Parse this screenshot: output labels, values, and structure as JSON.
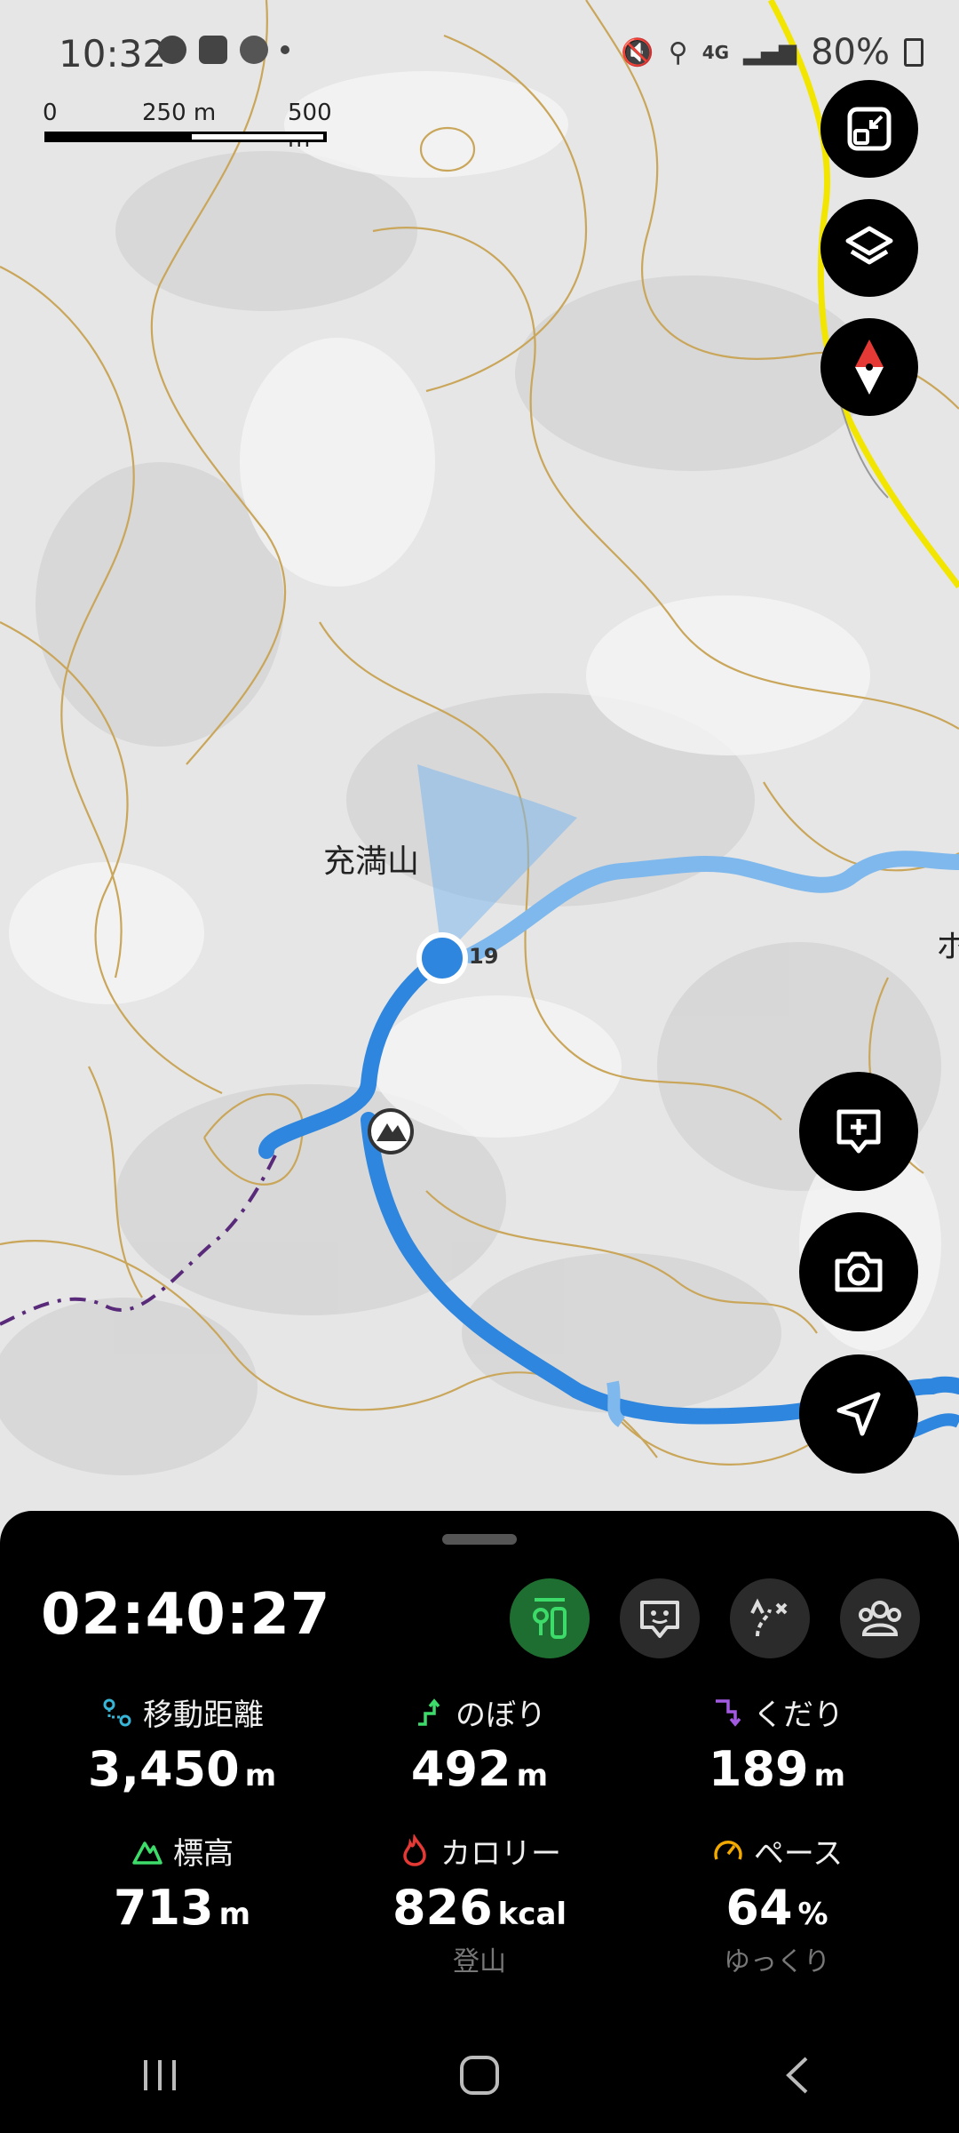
{
  "status_bar": {
    "time": "10:32",
    "battery": "80%",
    "network": "4G"
  },
  "map": {
    "scale_labels": [
      "0",
      "250 m",
      "500 m"
    ],
    "peak_label": "充満山",
    "waypoint_label": "19",
    "edge_label": "ホ",
    "colors": {
      "track": "#2e86de",
      "road": "#f2e600",
      "contour": "#c9a65a"
    }
  },
  "tracking": {
    "elapsed": "02:40:27",
    "active_mode": "hiking-icon",
    "stats": [
      {
        "icon": "distance-icon",
        "label": "移動距離",
        "value": "3,450",
        "unit": "m",
        "sub": ""
      },
      {
        "icon": "ascent-icon",
        "label": "のぼり",
        "value": "492",
        "unit": "m",
        "sub": ""
      },
      {
        "icon": "descent-icon",
        "label": "くだり",
        "value": "189",
        "unit": "m",
        "sub": ""
      },
      {
        "icon": "elevation-icon",
        "label": "標高",
        "value": "713",
        "unit": "m",
        "sub": ""
      },
      {
        "icon": "calorie-icon",
        "label": "カロリー",
        "value": "826",
        "unit": "kcal",
        "sub": "登山"
      },
      {
        "icon": "pace-icon",
        "label": "ペース",
        "value": "64",
        "unit": "%",
        "sub": "ゆっくり"
      }
    ]
  }
}
